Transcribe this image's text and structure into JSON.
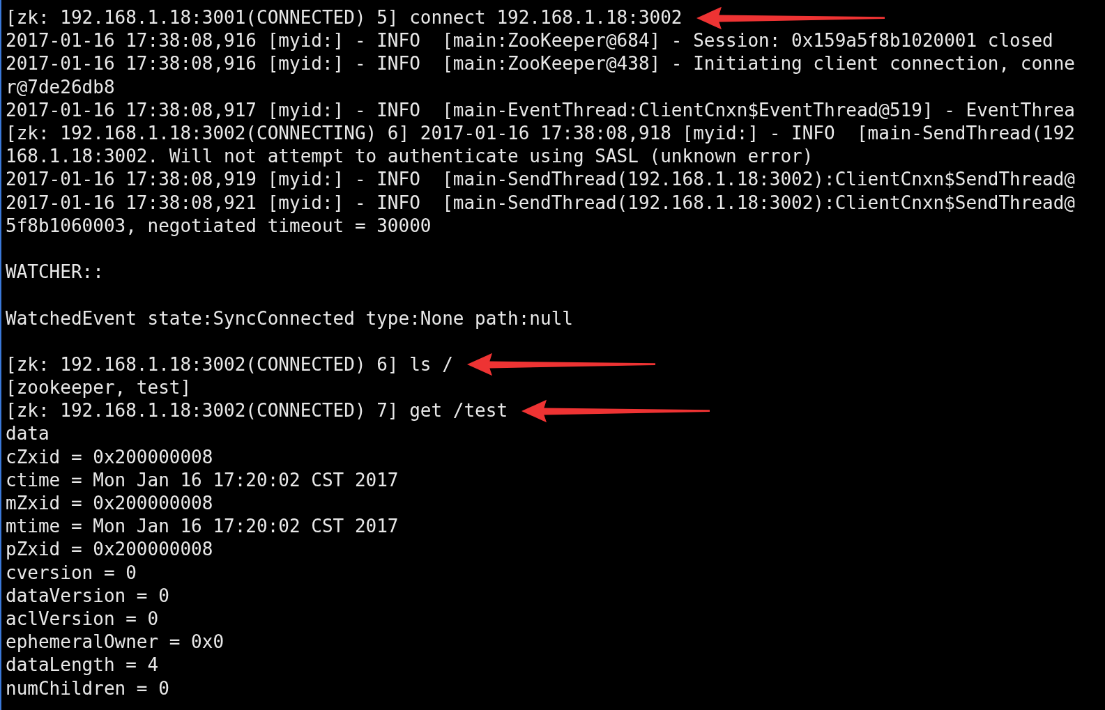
{
  "terminal": {
    "lines": [
      {
        "kind": "text",
        "text": "[zk: 192.168.1.18:3001(CONNECTED) 5] connect 192.168.1.18:3002",
        "arrow": true
      },
      {
        "kind": "text",
        "text": "2017-01-16 17:38:08,916 [myid:] - INFO  [main:ZooKeeper@684] - Session: 0x159a5f8b1020001 closed",
        "arrow": false
      },
      {
        "kind": "text",
        "text": "2017-01-16 17:38:08,916 [myid:] - INFO  [main:ZooKeeper@438] - Initiating client connection, conne",
        "arrow": false
      },
      {
        "kind": "text",
        "text": "r@7de26db8",
        "arrow": false
      },
      {
        "kind": "text",
        "text": "2017-01-16 17:38:08,917 [myid:] - INFO  [main-EventThread:ClientCnxn$EventThread@519] - EventThrea",
        "arrow": false
      },
      {
        "kind": "text",
        "text": "[zk: 192.168.1.18:3002(CONNECTING) 6] 2017-01-16 17:38:08,918 [myid:] - INFO  [main-SendThread(192",
        "arrow": false
      },
      {
        "kind": "text",
        "text": "168.1.18:3002. Will not attempt to authenticate using SASL (unknown error)",
        "arrow": false
      },
      {
        "kind": "text",
        "text": "2017-01-16 17:38:08,919 [myid:] - INFO  [main-SendThread(192.168.1.18:3002):ClientCnxn$SendThread@",
        "arrow": false
      },
      {
        "kind": "text",
        "text": "2017-01-16 17:38:08,921 [myid:] - INFO  [main-SendThread(192.168.1.18:3002):ClientCnxn$SendThread@",
        "arrow": false
      },
      {
        "kind": "text",
        "text": "5f8b1060003, negotiated timeout = 30000",
        "arrow": false
      },
      {
        "kind": "blank"
      },
      {
        "kind": "text",
        "text": "WATCHER::",
        "arrow": false
      },
      {
        "kind": "blank"
      },
      {
        "kind": "text",
        "text": "WatchedEvent state:SyncConnected type:None path:null",
        "arrow": false
      },
      {
        "kind": "blank"
      },
      {
        "kind": "text",
        "text": "[zk: 192.168.1.18:3002(CONNECTED) 6] ls /",
        "arrow": true
      },
      {
        "kind": "text",
        "text": "[zookeeper, test]",
        "arrow": false
      },
      {
        "kind": "text",
        "text": "[zk: 192.168.1.18:3002(CONNECTED) 7] get /test",
        "arrow": true
      },
      {
        "kind": "text",
        "text": "data",
        "arrow": false
      },
      {
        "kind": "text",
        "text": "cZxid = 0x200000008",
        "arrow": false
      },
      {
        "kind": "text",
        "text": "ctime = Mon Jan 16 17:20:02 CST 2017",
        "arrow": false
      },
      {
        "kind": "text",
        "text": "mZxid = 0x200000008",
        "arrow": false
      },
      {
        "kind": "text",
        "text": "mtime = Mon Jan 16 17:20:02 CST 2017",
        "arrow": false
      },
      {
        "kind": "text",
        "text": "pZxid = 0x200000008",
        "arrow": false
      },
      {
        "kind": "text",
        "text": "cversion = 0",
        "arrow": false
      },
      {
        "kind": "text",
        "text": "dataVersion = 0",
        "arrow": false
      },
      {
        "kind": "text",
        "text": "aclVersion = 0",
        "arrow": false
      },
      {
        "kind": "text",
        "text": "ephemeralOwner = 0x0",
        "arrow": false
      },
      {
        "kind": "text",
        "text": "dataLength = 4",
        "arrow": false
      },
      {
        "kind": "text",
        "text": "numChildren = 0",
        "arrow": false
      }
    ]
  }
}
